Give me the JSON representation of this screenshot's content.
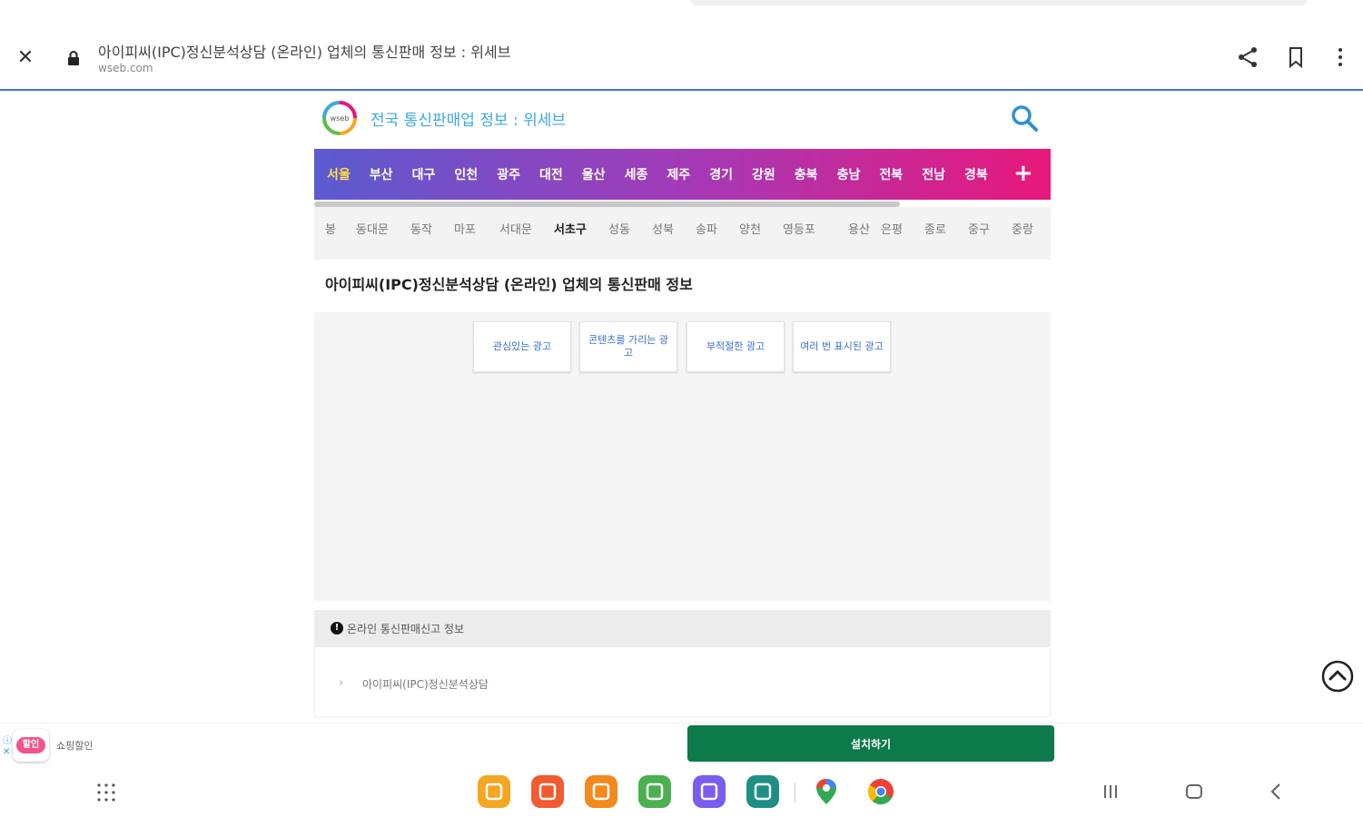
{
  "browser": {
    "page_title": "아이피씨(IPC)정신분석상담 (온라인) 업체의 통신판매 정보 : 위세브",
    "url": "wseb.com"
  },
  "site": {
    "name": "전국 통신판매업 정보 : 위세브",
    "logo_text": "wseb"
  },
  "regions": {
    "items": [
      "서울",
      "부산",
      "대구",
      "인천",
      "광주",
      "대전",
      "울산",
      "세종",
      "제주",
      "경기",
      "강원",
      "충북",
      "충남",
      "전북",
      "전남",
      "경북"
    ],
    "active": "서울",
    "more": "+"
  },
  "districts": {
    "items": [
      "봉",
      "동대문",
      "동작",
      "마포",
      "서대문",
      "서초구",
      "성동",
      "성북",
      "송파",
      "양천",
      "영등포",
      "용산",
      "은평",
      "종로",
      "중구",
      "중랑"
    ],
    "active": "서초구"
  },
  "business": {
    "title": "아이피씨(IPC)정신분석상담 (온라인) 업체의 통신판매 정보"
  },
  "ad_buttons": [
    "관심있는 광고",
    "콘텐츠를 가리는 광고",
    "부적절한 광고",
    "여러 번 표시된 광고"
  ],
  "info": {
    "header_icon": "!",
    "header": "온라인 통신판매신고 정보",
    "arrow": "›",
    "value": "아이피씨(IPC)정신분석상담"
  },
  "ad_banner": {
    "logo_label": "할인",
    "text": "쇼핑할인",
    "install_label": "설치하기",
    "marks": [
      "ⓘ",
      "✕"
    ]
  },
  "colors": {
    "accent": "#4a74c9",
    "region_gradient": [
      "#5b5bd0",
      "#a33ab8",
      "#e8187a"
    ],
    "install": "#0c7a4a",
    "active_region": "#ffe14a"
  },
  "dock": {
    "apps": [
      {
        "name": "folder-app",
        "color": "#f5a623"
      },
      {
        "name": "notes-app",
        "color": "#f25a2f"
      },
      {
        "name": "contacts-app",
        "color": "#f28a1e"
      },
      {
        "name": "calculator-app",
        "color": "#4caf50"
      },
      {
        "name": "internet-app",
        "color": "#7b5cf0"
      },
      {
        "name": "calendar-app",
        "color": "#1f8f86"
      },
      {
        "name": "maps-app",
        "color": "#ffffff"
      },
      {
        "name": "chrome-app",
        "color": "#ffffff"
      }
    ]
  }
}
